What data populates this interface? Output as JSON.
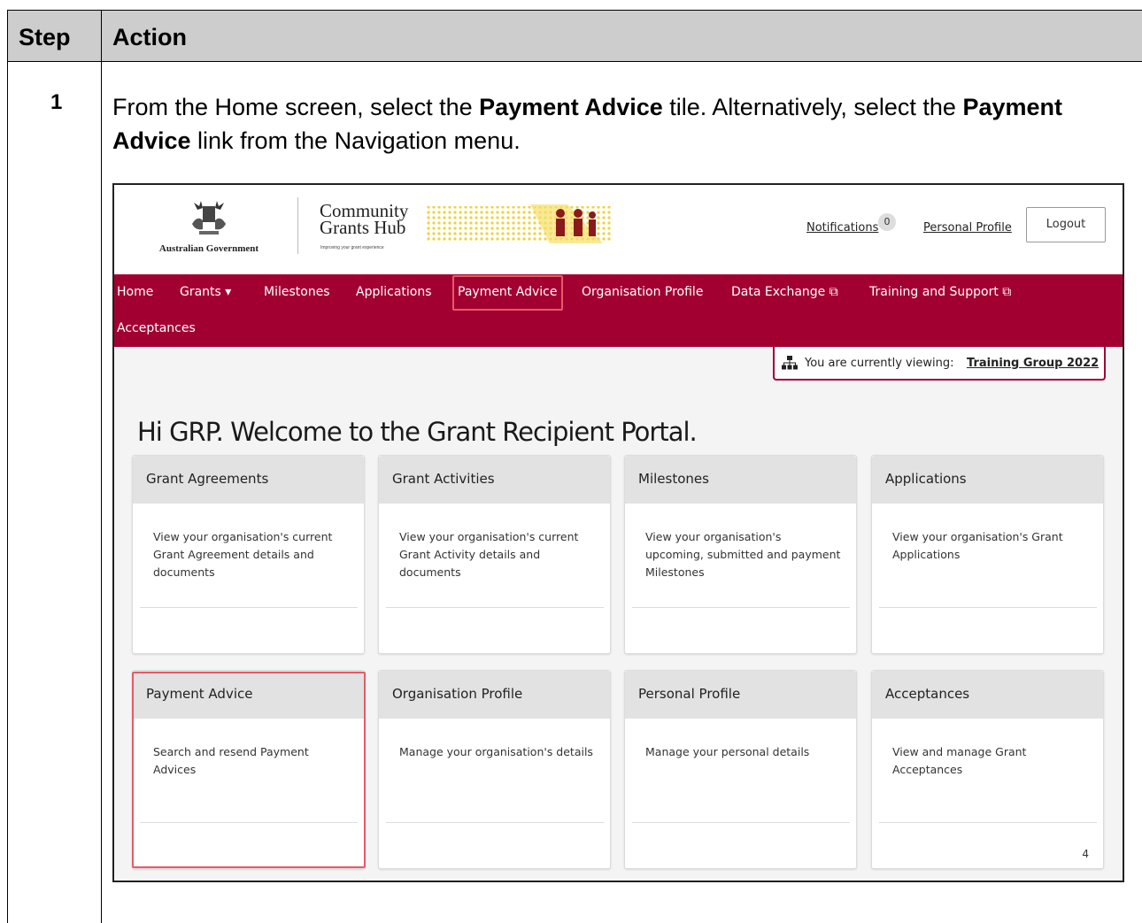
{
  "doc": {
    "header_step": "Step",
    "header_action": "Action",
    "step_number": "1",
    "instruction": {
      "t1": "From the Home screen, select the ",
      "b1": "Payment Advice",
      "t2": " tile. Alternatively, select the ",
      "b2": "Payment Advice",
      "t3": " link from the Navigation menu."
    }
  },
  "portal": {
    "gov_label": "Australian Government",
    "brand_line1": "Community",
    "brand_line2": "Grants Hub",
    "brand_tagline": "Improving your grant experience",
    "notifications_label": "Notifications",
    "notifications_count": "0",
    "personal_profile_link": "Personal Profile",
    "logout_label": "Logout",
    "nav": {
      "home": "Home",
      "grants": "Grants ▾",
      "milestones": "Milestones",
      "applications": "Applications",
      "payment_advice": "Payment Advice",
      "organisation_profile": "Organisation Profile",
      "data_exchange": "Data Exchange ⧉",
      "training_support": "Training and Support ⧉",
      "acceptances": "Acceptances"
    },
    "viewing_label": "You are currently viewing:",
    "viewing_org": "Training Group 2022",
    "welcome": "Hi GRP. Welcome to the Grant Recipient Portal.",
    "tiles": [
      {
        "title": "Grant Agreements",
        "desc": "View your organisation's current Grant Agreement details and documents"
      },
      {
        "title": "Grant Activities",
        "desc": "View your organisation's current Grant Activity details and documents"
      },
      {
        "title": "Milestones",
        "desc": "View your organisation's upcoming, submitted and payment Milestones"
      },
      {
        "title": "Applications",
        "desc": "View your organisation's Grant Applications"
      },
      {
        "title": "Payment Advice",
        "desc": "Search and resend Payment Advices"
      },
      {
        "title": "Organisation Profile",
        "desc": "Manage your organisation's details"
      },
      {
        "title": "Personal Profile",
        "desc": "Manage your personal details"
      },
      {
        "title": "Acceptances",
        "desc": "View and manage Grant Acceptances",
        "count": "4"
      }
    ],
    "colors": {
      "nav_bg": "#a30032",
      "highlight": "#e85a64",
      "tile_head": "#e2e2e2"
    }
  }
}
